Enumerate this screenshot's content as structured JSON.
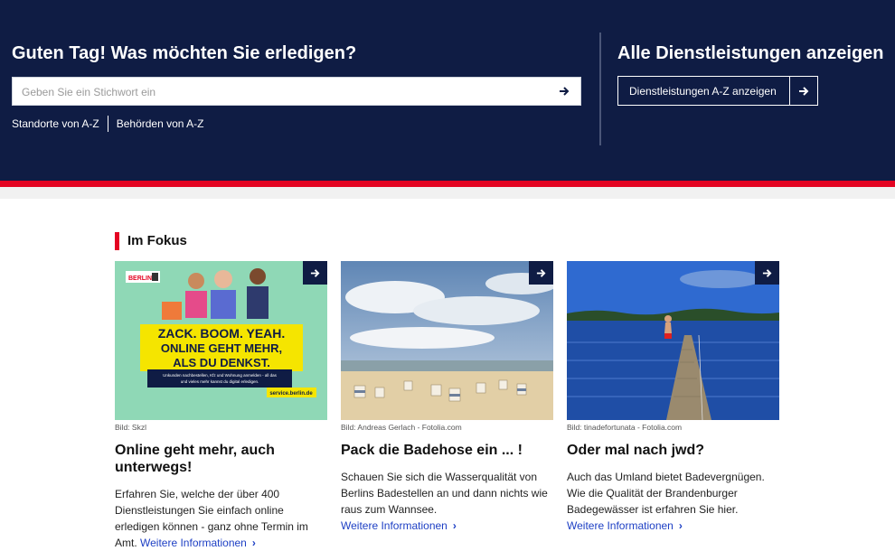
{
  "header": {
    "greeting": "Guten Tag! Was möchten Sie erledigen?",
    "search_placeholder": "Geben Sie ein Stichwort ein",
    "links": [
      "Standorte von A-Z",
      "Behörden von A-Z"
    ],
    "services_title": "Alle Dienstleistungen anzeigen",
    "services_button": "Dienstleistungen A-Z anzeigen"
  },
  "focus": {
    "title": "Im Fokus",
    "cards": [
      {
        "credit": "Bild: Skzl",
        "title": "Online geht mehr, auch unterwegs!",
        "text": "Erfahren Sie, welche der über 400 Dienstleistungen Sie einfach online erledigen können - ganz ohne Termin im Amt.",
        "more": "Weitere Informationen",
        "poster": {
          "logo": "BERLIN",
          "headline1": "ZACK. BOOM. YEAH.",
          "headline2": "ONLINE GEHT MEHR,",
          "headline3": "ALS DU DENKST.",
          "small1": "Unkunden nachbestellen, Kfz und Wohnung anmelden - all das",
          "small2": "und vieles mehr kannst du digital erledigen.",
          "url": "service.berlin.de"
        }
      },
      {
        "credit": "Bild: Andreas Gerlach - Fotolia.com",
        "title": "Pack die Badehose ein ... !",
        "text": "Schauen Sie sich die Wasserqualität von Berlins Badestellen an und dann nichts wie raus zum Wannsee.",
        "more": "Weitere Informationen"
      },
      {
        "credit": "Bild: tinadefortunata - Fotolia.com",
        "title": "Oder mal nach jwd?",
        "text": "Auch das Umland bietet Badevergnügen. Wie die Qualität der Brandenburger Badegewässer ist erfahren Sie hier.",
        "more": "Weitere Informationen"
      }
    ]
  },
  "colors": {
    "navy": "#0f1c44",
    "red": "#e40422",
    "link": "#1d3fc4",
    "poster_bg": "#8fd8b6",
    "poster_yellow": "#f5e500"
  },
  "icons": {
    "arrow": "arrow-right-icon",
    "chevron": "chevron-right-icon"
  }
}
